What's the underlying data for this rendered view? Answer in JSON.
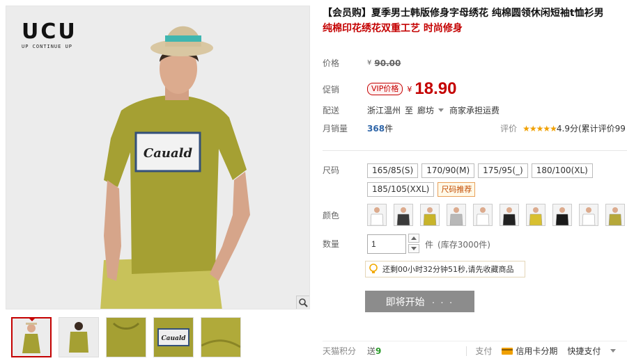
{
  "gallery": {
    "brand_name": "UCU",
    "brand_tagline": "UP CONTINUE UP",
    "shirt_print": "Cauald",
    "thumb_print": "Cauald"
  },
  "product": {
    "title": "【会员购】夏季男士韩版修身字母绣花 纯棉圆领休闲短袖t恤衫男",
    "subtitle": "纯棉印花绣花双重工艺 时尚修身"
  },
  "price_row": {
    "label": "价格",
    "currency": "¥",
    "original": "90.00"
  },
  "promo_row": {
    "label": "促销",
    "vip_badge": "VIP价格",
    "currency": "¥",
    "price": "18.90"
  },
  "shipping_row": {
    "label": "配送",
    "from": "浙江温州",
    "to_word": "至",
    "to": "廊坊",
    "fee": "商家承担运费"
  },
  "sales_row": {
    "label": "月销量",
    "count": "368",
    "unit": "件",
    "rating_label": "评价",
    "stars": "★★★★★",
    "score": "4.9分(累计评价99"
  },
  "size_row": {
    "label": "尺码",
    "options": [
      "165/85(S)",
      "170/90(M)",
      "175/95(_)",
      "180/100(XL)",
      "185/105(XXL)"
    ],
    "recommend": "尺码推荐"
  },
  "color_row": {
    "label": "颜色",
    "swatch_colors": [
      "#ffffff",
      "#3a3a3a",
      "#c8b42a",
      "#b8b8b8",
      "#ffffff",
      "#222222",
      "#d8c030",
      "#1a1a1a",
      "#ffffff",
      "#b6a83a"
    ]
  },
  "quantity_row": {
    "label": "数量",
    "value": "1",
    "unit": "件",
    "stock": "(库存3000件)"
  },
  "countdown": {
    "text": "还剩00小时32分钟51秒,请先收藏商品"
  },
  "buy_button": {
    "label": "即将开始",
    "dots": "· · ·"
  },
  "bottom": {
    "points_label": "天猫积分",
    "points_prefix": "送",
    "points_value": "9",
    "payment_label": "支付",
    "installment": "信用卡分期",
    "quick_pay": "快捷支付"
  },
  "colors": {
    "accent": "#c40000",
    "link": "#2e65a8",
    "shirt": "#a5a033"
  }
}
